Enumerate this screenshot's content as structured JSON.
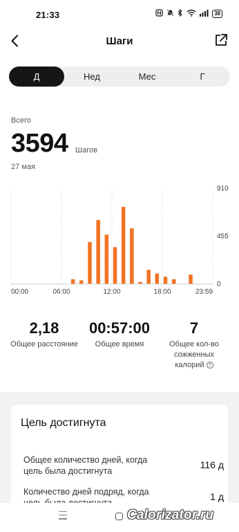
{
  "status_bar": {
    "time": "21:33",
    "icons": [
      "nfc-icon",
      "mute-icon",
      "bluetooth-icon",
      "wifi-icon",
      "signal-icon"
    ],
    "battery": "38"
  },
  "header": {
    "title": "Шаги",
    "back_icon": "chevron-left-icon",
    "share_icon": "share-icon"
  },
  "tabs": [
    {
      "label": "Д",
      "active": true
    },
    {
      "label": "Нед",
      "active": false
    },
    {
      "label": "Мес",
      "active": false
    },
    {
      "label": "Г",
      "active": false
    }
  ],
  "summary": {
    "label": "Всего",
    "value": "3594",
    "unit": "Шагов",
    "date": "27 мая"
  },
  "chart_data": {
    "type": "bar",
    "color": "#f07323",
    "x_ticks": [
      "00:00",
      "06:00",
      "12:00",
      "18:00",
      "23:59"
    ],
    "y_ticks": [
      "910",
      "455",
      "0"
    ],
    "ylim": [
      0,
      910
    ],
    "xlim_hours": [
      0,
      24
    ],
    "grid": "dashed-vertical",
    "bars": [
      {
        "hour": 7.0,
        "value": 45
      },
      {
        "hour": 8.0,
        "value": 35
      },
      {
        "hour": 9.0,
        "value": 400
      },
      {
        "hour": 10.0,
        "value": 610
      },
      {
        "hour": 11.0,
        "value": 470
      },
      {
        "hour": 12.0,
        "value": 350
      },
      {
        "hour": 13.0,
        "value": 735
      },
      {
        "hour": 14.0,
        "value": 530
      },
      {
        "hour": 15.0,
        "value": 20
      },
      {
        "hour": 16.0,
        "value": 135
      },
      {
        "hour": 17.0,
        "value": 100
      },
      {
        "hour": 18.0,
        "value": 70
      },
      {
        "hour": 19.0,
        "value": 45
      },
      {
        "hour": 21.0,
        "value": 90
      }
    ]
  },
  "stats": {
    "distance": {
      "value": "2,18",
      "label": "Общее расстояние"
    },
    "time": {
      "value": "00:57:00",
      "label": "Общее время"
    },
    "calories": {
      "value": "7",
      "label_line1": "Общее кол-во",
      "label_line2": "сожженных",
      "label_line3": "калорий"
    }
  },
  "goal": {
    "title": "Цель достигнута",
    "rows": [
      {
        "label_line1": "Общее количество дней, когда",
        "label_line2": "цель была достигнута",
        "value": "116 д"
      },
      {
        "label_line1": "Количество дней подряд, когда",
        "label_line2": "цель была достигнута",
        "value": "1 д"
      }
    ]
  },
  "nav": {
    "watermark": "Calorizator.ru"
  }
}
